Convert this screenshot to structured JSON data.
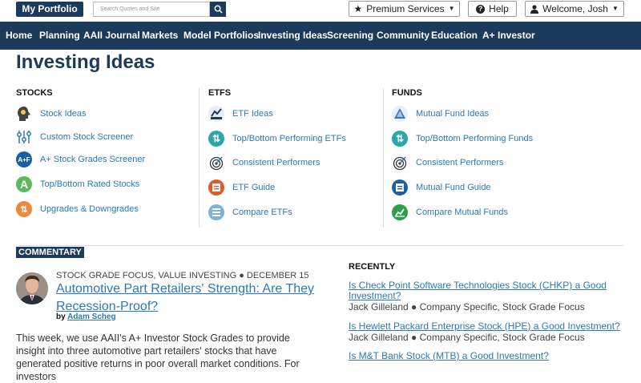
{
  "topbar": {
    "my_portfolio": "My Portfolio",
    "search_placeholder": "Search Quotes and Site",
    "premium": "Premium Services",
    "help": "Help",
    "welcome": "Welcome, Josh"
  },
  "nav": [
    "Home",
    "Planning",
    "AAII Journal",
    "Markets",
    "Model Portfolios",
    "Investing Ideas",
    "Screening",
    "Community",
    "Education",
    "A+ Investor"
  ],
  "page_title": "Investing Ideas",
  "columns": {
    "stocks": {
      "heading": "STOCKS",
      "items": [
        "Stock Ideas",
        "Custom Stock Screener",
        "A+ Stock Grades Screener",
        "Top/Bottom Rated Stocks",
        "Upgrades & Downgrades"
      ]
    },
    "etfs": {
      "heading": "ETFS",
      "items": [
        "ETF Ideas",
        "Top/Bottom Performing ETFs",
        "Consistent Performers",
        "ETF Guide",
        "Compare ETFs"
      ]
    },
    "funds": {
      "heading": "FUNDS",
      "items": [
        "Mutual Fund Ideas",
        "Top/Bottom Performing Funds",
        "Consistent Performers",
        "Mutual Fund Guide",
        "Compare Mutual Funds"
      ]
    }
  },
  "icons": {
    "aplus_text": "A+F",
    "a_text": "A"
  },
  "commentary": {
    "label": "COMMENTARY",
    "meta": "STOCK GRADE FOCUS, VALUE INVESTING ● DECEMBER 15",
    "headline": "Automotive Part Retailers' Strength: Are They Recession-Proof?",
    "by": "by",
    "author": "Adam Scheg",
    "body": "This week, we use AAII's A+ Investor Stock Grades to provide insight into three automotive part retailers' stocks that have generated positive returns in poor overall market conditions. For investors"
  },
  "recently": {
    "label": "RECENTLY",
    "items": [
      {
        "title": "Is Check Point Software Technologies Stock (CHKP) a Good Investment?",
        "meta": "Jack Gilleland ● Company Specific, Stock Grade Focus"
      },
      {
        "title": "Is Hewlett Packard Enterprise Stock (HPE) a Good Investment?",
        "meta": "Jack Gilleland ● Company Specific, Stock Grade Focus"
      },
      {
        "title": "Is M&T Bank Stock (MTB) a Good Investment?",
        "meta": ""
      }
    ]
  },
  "colors": {
    "navy": "#1b3a5c",
    "link": "#2a79b5"
  }
}
